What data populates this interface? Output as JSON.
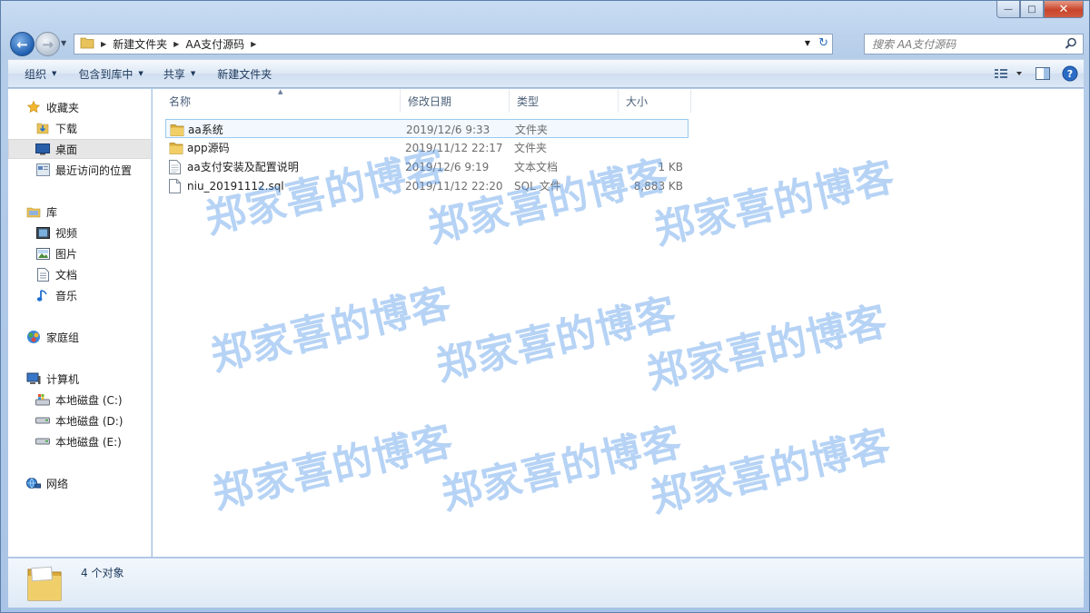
{
  "window": {
    "caption_buttons": [
      "minimize",
      "maximize",
      "close"
    ]
  },
  "address": {
    "crumbs": [
      "新建文件夹",
      "AA支付源码"
    ]
  },
  "search": {
    "placeholder": "搜索 AA支付源码"
  },
  "toolbar": {
    "organize": "组织",
    "include_in_library": "包含到库中",
    "share": "共享",
    "new_folder": "新建文件夹"
  },
  "nav": {
    "favorites": "收藏夹",
    "downloads": "下载",
    "desktop": "桌面",
    "recent": "最近访问的位置",
    "libraries": "库",
    "videos": "视频",
    "pictures": "图片",
    "documents": "文档",
    "music": "音乐",
    "homegroup": "家庭组",
    "computer": "计算机",
    "drive_c": "本地磁盘 (C:)",
    "drive_d": "本地磁盘 (D:)",
    "drive_e": "本地磁盘 (E:)",
    "network": "网络"
  },
  "columns": {
    "name": "名称",
    "date": "修改日期",
    "type": "类型",
    "size": "大小"
  },
  "files": [
    {
      "name": "aa系统",
      "date": "2019/12/6 9:33",
      "type": "文件夹",
      "size": "",
      "icon": "folder-icon"
    },
    {
      "name": "app源码",
      "date": "2019/11/12 22:17",
      "type": "文件夹",
      "size": "",
      "icon": "folder-icon"
    },
    {
      "name": "aa支付安装及配置说明",
      "date": "2019/12/6 9:19",
      "type": "文本文档",
      "size": "1 KB",
      "icon": "text-file-icon"
    },
    {
      "name": "niu_20191112.sql",
      "date": "2019/11/12 22:20",
      "type": "SQL 文件",
      "size": "8,883 KB",
      "icon": "sql-file-icon"
    }
  ],
  "status": {
    "count": "4 个对象"
  },
  "watermark": {
    "text": "郑家喜的博客"
  },
  "colors": {
    "watermark": "#5096e6",
    "selection": "#99c9ef",
    "close_button": "#c9452a"
  }
}
